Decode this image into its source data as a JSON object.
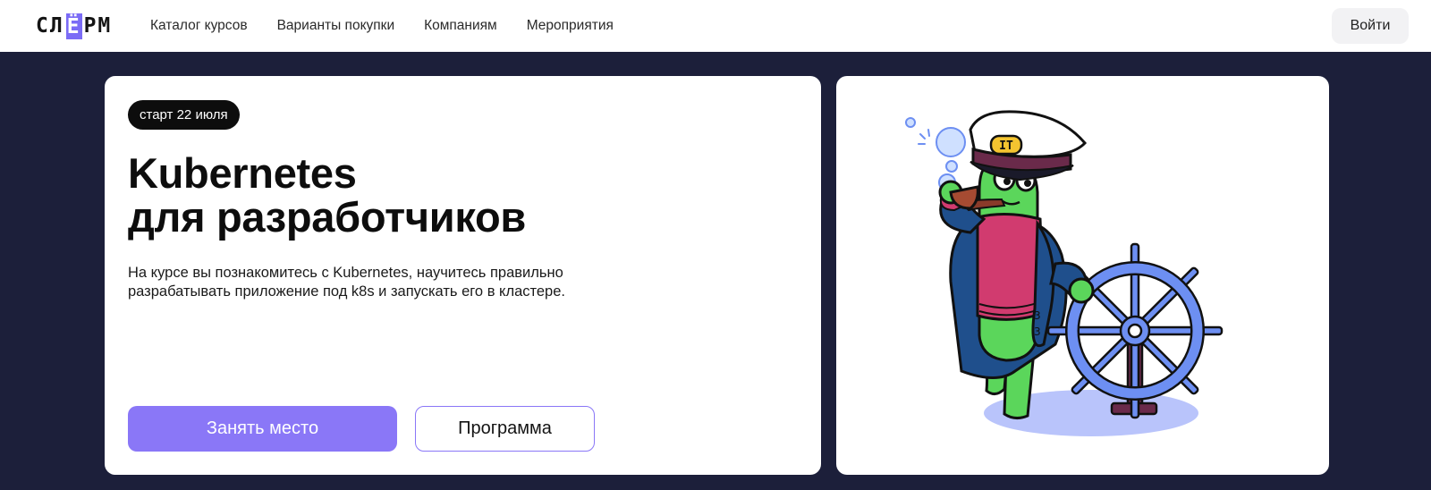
{
  "header": {
    "logo": {
      "pre": "СЛ",
      "highlight": "Ё",
      "post": "РМ"
    },
    "nav": [
      "Каталог курсов",
      "Варианты покупки",
      "Компаниям",
      "Мероприятия"
    ],
    "login_label": "Войти"
  },
  "hero": {
    "badge": "старт 22 июля",
    "title_line1": "Kubernetes",
    "title_line2": "для разработчиков",
    "description": "На курсе вы познакомитесь с Kubernetes, научитесь правильно разрабатывать приложение под k8s и запускать его в кластере.",
    "primary_button": "Занять место",
    "secondary_button": "Программа",
    "cap_badge": "IT"
  },
  "colors": {
    "accent": "#8a77f7",
    "background": "#1c1f3a",
    "mascot_green": "#5bd65b",
    "sweater": "#d13b6f",
    "coat": "#1f4f8c",
    "wheel": "#6d8ff2"
  }
}
